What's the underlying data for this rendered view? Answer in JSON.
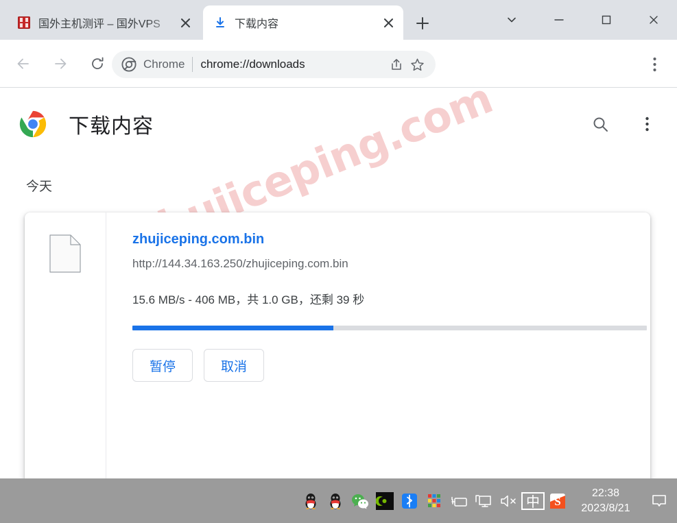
{
  "window": {
    "controls": [
      {
        "name": "tab-search",
        "icon": "chevron-down-icon"
      },
      {
        "name": "minimize",
        "icon": "minimize-icon"
      },
      {
        "name": "maximize",
        "icon": "maximize-icon"
      },
      {
        "name": "close",
        "icon": "close-icon"
      }
    ]
  },
  "tabs": [
    {
      "title": "国外主机测评 – 国外VPS",
      "active": false,
      "favicon": "seal-favicon-icon"
    },
    {
      "title": "下载内容",
      "active": true,
      "favicon": "download-icon"
    }
  ],
  "newtab_label": "+",
  "toolbar": {
    "back": "←",
    "forward": "→",
    "reload": "⟳",
    "omnibox": {
      "chip_label": "Chrome",
      "url": "chrome://downloads",
      "share_icon": "share-icon",
      "bookmark_icon": "star-icon"
    },
    "menu_icon": "three-dot-menu-icon"
  },
  "page": {
    "title": "下载内容",
    "logo": "chrome-logo-icon",
    "search_icon": "search-icon",
    "menu_icon": "three-dot-menu-icon",
    "date_group": "今天",
    "watermark": "zhujiceping.com"
  },
  "download": {
    "file_icon": "generic-file-icon",
    "filename": "zhujiceping.com.bin",
    "url": "http://144.34.163.250/zhujiceping.com.bin",
    "status": "15.6 MB/s - 406 MB，共 1.0 GB，还剩 39 秒",
    "progress_percent": 39,
    "progress_color": "#1a73e8",
    "buttons": [
      {
        "label": "暂停",
        "name": "pause-button"
      },
      {
        "label": "取消",
        "name": "cancel-button"
      }
    ]
  },
  "taskbar": {
    "background": "#9b9b9b",
    "tray_icons": [
      "qq-icon",
      "qq-icon",
      "wechat-icon",
      "nvidia-icon",
      "bluetooth-icon",
      "color-grid-icon",
      "power-icon",
      "display-icon",
      "volume-muted-icon"
    ],
    "ime_label": "中",
    "sogou_label": "S",
    "clock_time": "22:38",
    "clock_date": "2023/8/21",
    "notification_icon": "notification-bubble-icon"
  }
}
